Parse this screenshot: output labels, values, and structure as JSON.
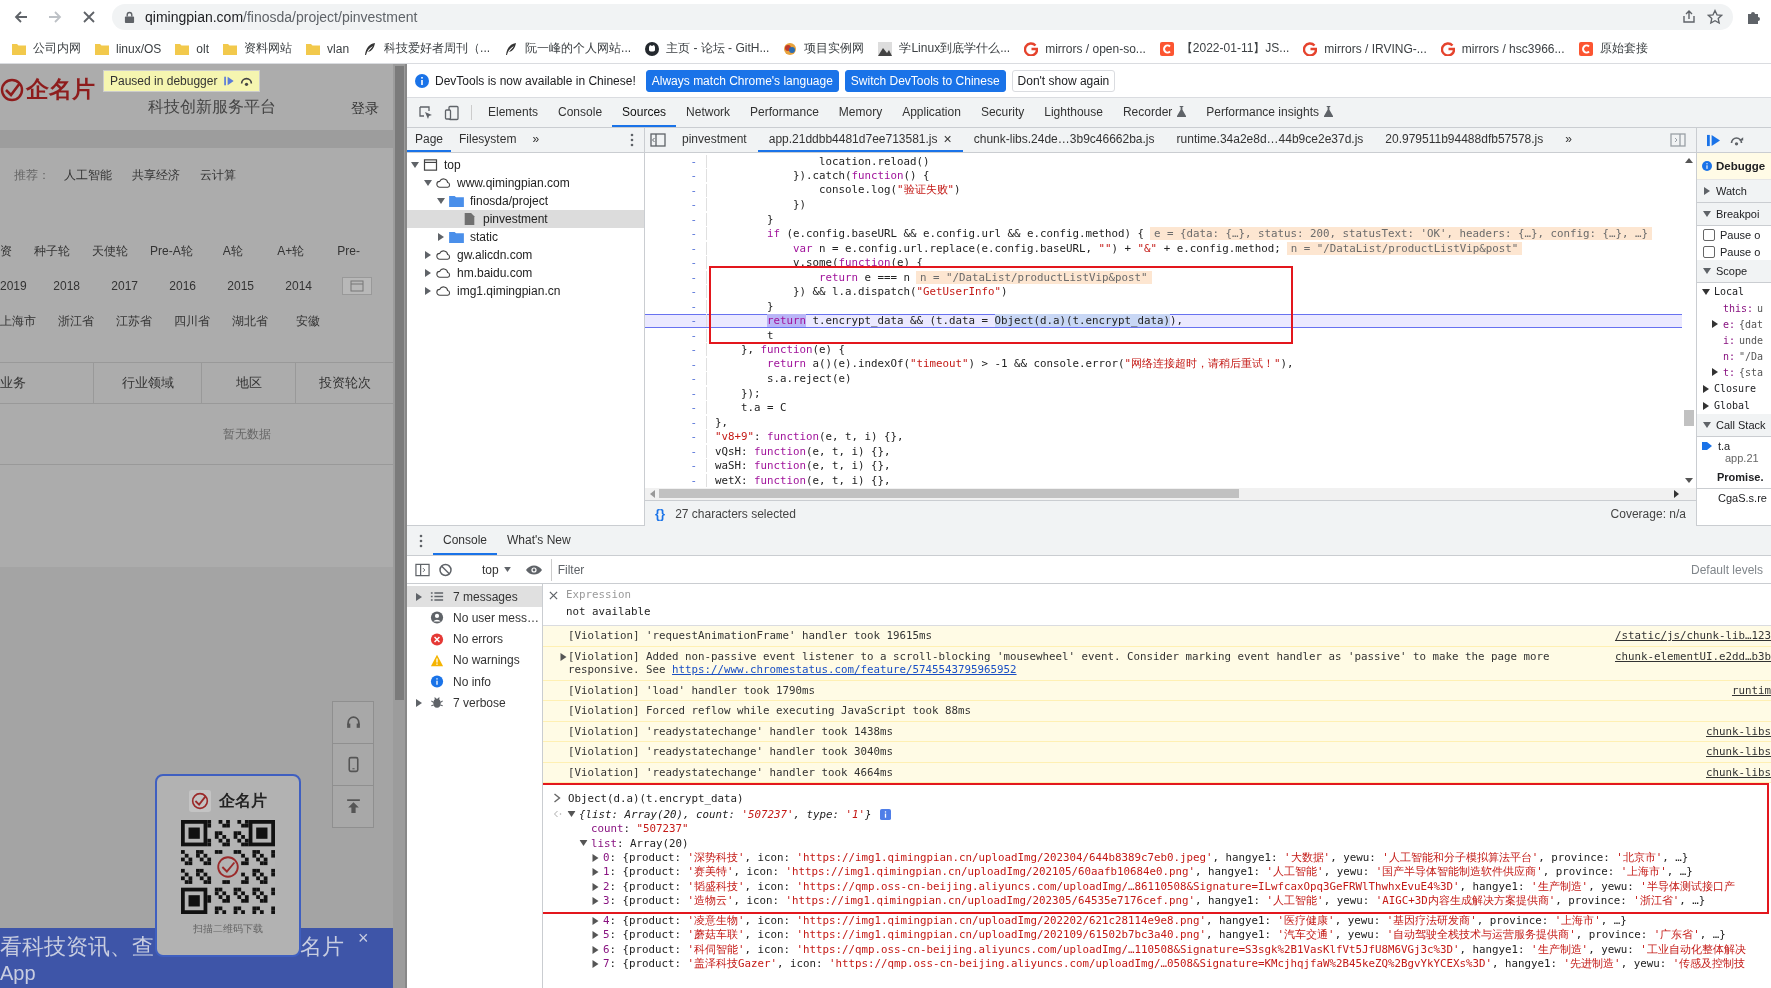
{
  "browser": {
    "url_host": "qimingpian.com",
    "url_path": "/finosda/project/pinvestment",
    "bookmarks": [
      {
        "label": "公司内网",
        "kind": "folder"
      },
      {
        "label": "linux/OS",
        "kind": "folder"
      },
      {
        "label": "olt",
        "kind": "folder"
      },
      {
        "label": "资料网站",
        "kind": "folder"
      },
      {
        "label": "vlan",
        "kind": "folder"
      },
      {
        "label": "科技爱好者周刊（...",
        "kind": "feather"
      },
      {
        "label": "阮一峰的个人网站...",
        "kind": "feather"
      },
      {
        "label": "主页 - 论坛 - GitH...",
        "kind": "cat"
      },
      {
        "label": "项目实例网",
        "kind": "colorful"
      },
      {
        "label": "学Linux到底学什么...",
        "kind": "photo"
      },
      {
        "label": "mirrors / open-so...",
        "kind": "g"
      },
      {
        "label": "【2022-01-11】JS...",
        "kind": "c"
      },
      {
        "label": "mirrors / IRVING-...",
        "kind": "g"
      },
      {
        "label": "mirrors / hsc3966...",
        "kind": "g"
      },
      {
        "label": "原始套接",
        "kind": "c"
      }
    ]
  },
  "page": {
    "brand": "企名片",
    "tagline": "科技创新服务平台",
    "login": "登录",
    "paused_label": "Paused in debugger",
    "recommend_label": "推荐：",
    "recommend": [
      "人工智能",
      "共享经济",
      "云计算"
    ],
    "filter_rows": [
      {
        "kind": "rounds",
        "items": [
          "资",
          "种子轮",
          "天使轮",
          "Pre-A轮",
          "A轮",
          "A+轮",
          "Pre-"
        ]
      },
      {
        "kind": "years",
        "items": [
          "2019",
          "2018",
          "2017",
          "2016",
          "2015",
          "2014"
        ]
      },
      {
        "kind": "regions",
        "items": [
          "上海市",
          "浙江省",
          "江苏省",
          "四川省",
          "湖北省",
          "安徽"
        ]
      }
    ],
    "table_headers": [
      "业务",
      "行业领域",
      "地区",
      "投资轮次"
    ],
    "empty": "暂无数据",
    "qr_brand": "企名片",
    "qr_caption": "扫描二维码下载",
    "banner_left": "看科技资讯、查",
    "banner_right": "名片",
    "banner_close": "×",
    "banner_app": "App"
  },
  "devtools": {
    "infobar": {
      "message": "DevTools is now available in Chinese!",
      "buttons": [
        {
          "label": "Always match Chrome's language",
          "kind": "primary"
        },
        {
          "label": "Switch DevTools to Chinese",
          "kind": "primary"
        },
        {
          "label": "Don't show again",
          "kind": "plain"
        }
      ]
    },
    "tabs": [
      {
        "label": "Elements",
        "selected": false,
        "kind": "panel"
      },
      {
        "label": "Console",
        "selected": false,
        "kind": "panel"
      },
      {
        "label": "Sources",
        "selected": true,
        "kind": "panel"
      },
      {
        "label": "Network",
        "selected": false,
        "kind": "panel"
      },
      {
        "label": "Performance",
        "selected": false,
        "kind": "panel"
      },
      {
        "label": "Memory",
        "selected": false,
        "kind": "panel"
      },
      {
        "label": "Application",
        "selected": false,
        "kind": "panel"
      },
      {
        "label": "Security",
        "selected": false,
        "kind": "panel"
      },
      {
        "label": "Lighthouse",
        "selected": false,
        "kind": "panel"
      },
      {
        "label": "Recorder",
        "selected": false,
        "kind": "experimental"
      },
      {
        "label": "Performance insights",
        "selected": false,
        "kind": "experimental"
      }
    ],
    "sources": {
      "nav_tabs": [
        {
          "label": "Page",
          "selected": true
        },
        {
          "label": "Filesystem",
          "selected": false
        }
      ],
      "nav_more": "»",
      "tree": [
        {
          "label": "top",
          "kind": "frame",
          "selected": false,
          "expanded": true,
          "children": [
            {
              "label": "www.qimingpian.com",
              "kind": "domain",
              "selected": false,
              "expanded": true,
              "children": [
                {
                  "label": "finosda/project",
                  "kind": "folder",
                  "selected": false,
                  "expanded": true,
                  "children": [
                    {
                      "label": "pinvestment",
                      "kind": "file",
                      "selected": true
                    }
                  ]
                },
                {
                  "label": "static",
                  "kind": "folder",
                  "selected": false,
                  "expanded": false
                }
              ]
            },
            {
              "label": "gw.alicdn.com",
              "kind": "domain",
              "selected": false,
              "expanded": false
            },
            {
              "label": "hm.baidu.com",
              "kind": "domain",
              "selected": false,
              "expanded": false
            },
            {
              "label": "img1.qimingpian.cn",
              "kind": "domain",
              "selected": false,
              "expanded": false
            }
          ]
        }
      ],
      "file_tabs": [
        {
          "label": "pinvestment",
          "selected": false
        },
        {
          "label": "app.21ddbb4481d7ee713581.js",
          "selected": true,
          "close": "×"
        },
        {
          "label": "chunk-libs.24de…3b9c46662ba.js",
          "selected": false
        },
        {
          "label": "runtime.34a2e8d…44b9ce2e37d.js",
          "selected": false
        },
        {
          "label": "20.979511b94488dfb57578.js",
          "selected": false
        }
      ],
      "file_more": "»",
      "code": [
        {
          "mark": "-",
          "current": false,
          "segs": [
            {
              "text": "                location.reload()",
              "kind": "plain"
            }
          ]
        },
        {
          "mark": "-",
          "current": false,
          "segs": [
            {
              "text": "            }).catch(",
              "kind": "plain"
            },
            {
              "text": "function",
              "kind": "keyword"
            },
            {
              "text": "() {",
              "kind": "plain"
            }
          ]
        },
        {
          "mark": "-",
          "current": false,
          "segs": [
            {
              "text": "                console.log(",
              "kind": "plain"
            },
            {
              "text": "\"验证失败\"",
              "kind": "string"
            },
            {
              "text": ")",
              "kind": "plain"
            }
          ]
        },
        {
          "mark": "-",
          "current": false,
          "segs": [
            {
              "text": "            })",
              "kind": "plain"
            }
          ]
        },
        {
          "mark": "-",
          "current": false,
          "segs": [
            {
              "text": "        }",
              "kind": "plain"
            }
          ]
        },
        {
          "mark": "-",
          "current": false,
          "segs": [
            {
              "text": "        if",
              "kind": "keyword"
            },
            {
              "text": " (e.config.baseURL && e.config.url && e.config.method) {",
              "kind": "plain"
            },
            {
              "text": "e = {data: {…}, status: 200, statusText: 'OK', headers: {…}, config: {…}, …}",
              "kind": "hint"
            }
          ]
        },
        {
          "mark": "-",
          "current": false,
          "segs": [
            {
              "text": "            var",
              "kind": "keyword"
            },
            {
              "text": " n = e.config.url.replace(e.config.baseURL, ",
              "kind": "plain"
            },
            {
              "text": "\"\"",
              "kind": "string"
            },
            {
              "text": ") + ",
              "kind": "plain"
            },
            {
              "text": "\"&\"",
              "kind": "string"
            },
            {
              "text": " + e.config.method;",
              "kind": "plain"
            },
            {
              "text": "n = \"/DataList/productListVip&post\"",
              "kind": "hint"
            }
          ]
        },
        {
          "mark": "-",
          "current": false,
          "segs": [
            {
              "text": "            v.some(",
              "kind": "plain"
            },
            {
              "text": "function",
              "kind": "keyword"
            },
            {
              "text": "(e) {",
              "kind": "plain"
            }
          ]
        },
        {
          "mark": "-",
          "current": false,
          "segs": [
            {
              "text": "                return",
              "kind": "keyword"
            },
            {
              "text": " e === n",
              "kind": "plain"
            },
            {
              "text": "n = \"/DataList/productListVip&post\"",
              "kind": "hint"
            }
          ]
        },
        {
          "mark": "-",
          "current": false,
          "segs": [
            {
              "text": "            }) && l.a.dispatch(",
              "kind": "plain"
            },
            {
              "text": "\"GetUserInfo\"",
              "kind": "string"
            },
            {
              "text": ")",
              "kind": "plain"
            }
          ]
        },
        {
          "mark": "-",
          "current": false,
          "segs": [
            {
              "text": "        }",
              "kind": "plain"
            }
          ]
        },
        {
          "mark": "-",
          "current": true,
          "segs": [
            {
              "text": "        return",
              "kind": "paused"
            },
            {
              "text": " t.encrypt_data && (t.data = ",
              "kind": "plain"
            },
            {
              "text": "Object(d.a)(t.encrypt_data)",
              "kind": "selection"
            },
            {
              "text": "),",
              "kind": "plain"
            }
          ]
        },
        {
          "mark": "-",
          "current": false,
          "segs": [
            {
              "text": "        t",
              "kind": "plain"
            }
          ]
        },
        {
          "mark": "-",
          "current": false,
          "segs": [
            {
              "text": "    }, ",
              "kind": "plain"
            },
            {
              "text": "function",
              "kind": "keyword"
            },
            {
              "text": "(e) {",
              "kind": "plain"
            }
          ]
        },
        {
          "mark": "-",
          "current": false,
          "segs": [
            {
              "text": "        return",
              "kind": "keyword"
            },
            {
              "text": " a()(e).indexOf(",
              "kind": "plain"
            },
            {
              "text": "\"timeout\"",
              "kind": "string"
            },
            {
              "text": ") > -1 && console.error(",
              "kind": "plain"
            },
            {
              "text": "\"网络连接超时，请稍后重试！\"",
              "kind": "string"
            },
            {
              "text": "),",
              "kind": "plain"
            }
          ]
        },
        {
          "mark": "-",
          "current": false,
          "segs": [
            {
              "text": "        s.a.reject(e)",
              "kind": "plain"
            }
          ]
        },
        {
          "mark": "-",
          "current": false,
          "segs": [
            {
              "text": "    });",
              "kind": "plain"
            }
          ]
        },
        {
          "mark": "-",
          "current": false,
          "segs": [
            {
              "text": "    t.a = C",
              "kind": "plain"
            }
          ]
        },
        {
          "mark": "-",
          "current": false,
          "segs": [
            {
              "text": "},",
              "kind": "plain"
            }
          ]
        },
        {
          "mark": "-",
          "current": false,
          "segs": [
            {
              "text": "\"v8+9\"",
              "kind": "string"
            },
            {
              "text": ": ",
              "kind": "plain"
            },
            {
              "text": "function",
              "kind": "keyword"
            },
            {
              "text": "(e, t, i) {},",
              "kind": "plain"
            }
          ]
        },
        {
          "mark": "-",
          "current": false,
          "segs": [
            {
              "text": "vQsH: ",
              "kind": "plain"
            },
            {
              "text": "function",
              "kind": "keyword"
            },
            {
              "text": "(e, t, i) {},",
              "kind": "plain"
            }
          ]
        },
        {
          "mark": "-",
          "current": false,
          "segs": [
            {
              "text": "waSH: ",
              "kind": "plain"
            },
            {
              "text": "function",
              "kind": "keyword"
            },
            {
              "text": "(e, t, i) {},",
              "kind": "plain"
            }
          ]
        },
        {
          "mark": "-",
          "current": false,
          "segs": [
            {
              "text": "wetX: ",
              "kind": "plain"
            },
            {
              "text": "function",
              "kind": "keyword"
            },
            {
              "text": "(e, t, i) {},",
              "kind": "plain"
            }
          ]
        }
      ],
      "format_label": "{}",
      "status": "27 characters selected",
      "coverage": "Coverage: n/a"
    },
    "debugger": [
      {
        "kind": "notice",
        "label": "Debugge"
      },
      {
        "kind": "section",
        "label": "Watch",
        "expanded": false
      },
      {
        "kind": "section",
        "label": "Breakpoi",
        "expanded": true
      },
      {
        "kind": "checkbox",
        "label": "Pause o",
        "checked": false
      },
      {
        "kind": "checkbox",
        "label": "Pause o",
        "checked": false
      },
      {
        "kind": "section",
        "label": "Scope",
        "expanded": true
      },
      {
        "kind": "group",
        "label": "Local",
        "expanded": true
      },
      {
        "kind": "var",
        "name": "this:",
        "value": "u"
      },
      {
        "kind": "objvar",
        "name": "e:",
        "value": "{dat",
        "expanded": false
      },
      {
        "kind": "var",
        "name": "i:",
        "value": "unde"
      },
      {
        "kind": "var",
        "name": "n:",
        "value": "\"/Da"
      },
      {
        "kind": "objvar",
        "name": "t:",
        "value": "{sta",
        "expanded": false
      },
      {
        "kind": "group",
        "label": "Closure",
        "expanded": false
      },
      {
        "kind": "group",
        "label": "Global",
        "expanded": false
      },
      {
        "kind": "section",
        "label": "Call Stack",
        "expanded": true
      },
      {
        "kind": "frame",
        "label": "t.a",
        "sub": "app.21",
        "current": true
      },
      {
        "kind": "async",
        "label": "Promise."
      },
      {
        "kind": "frame",
        "label": "CgaS.s.re",
        "current": false
      }
    ]
  },
  "console": {
    "tabs": [
      {
        "label": "Console",
        "selected": true
      },
      {
        "label": "What's New",
        "selected": false
      }
    ],
    "context": "top",
    "filter_placeholder": "Filter",
    "levels": "Default levels",
    "sidebar": [
      {
        "label": "7 messages",
        "kind": "messages",
        "selected": true,
        "expanded": false
      },
      {
        "label": "No user mess…",
        "kind": "user",
        "selected": false
      },
      {
        "label": "No errors",
        "kind": "errors",
        "selected": false
      },
      {
        "label": "No warnings",
        "kind": "warnings",
        "selected": false
      },
      {
        "label": "No info",
        "kind": "info",
        "selected": false
      },
      {
        "label": "7 verbose",
        "kind": "verbose",
        "selected": false,
        "expanded": false
      }
    ],
    "expression": {
      "title": "Expression",
      "value": "not available"
    },
    "violations": [
      {
        "text": "[Violation] 'requestAnimationFrame' handler took 19615ms",
        "source": "/static/js/chunk-lib…123"
      },
      {
        "text": "[Violation] Added non-passive event listener to a scroll-blocking 'mousewheel' event. Consider marking event handler as 'passive' to make the page more responsive. See ",
        "url": "https://www.chromestatus.com/feature/5745543795965952",
        "source": "chunk-elementUI.e2dd…b3b",
        "expanded": false
      },
      {
        "text": "[Violation] 'load' handler took 1790ms",
        "source": "runtim"
      },
      {
        "text": "[Violation] Forced reflow while executing JavaScript took 88ms"
      },
      {
        "text": "[Violation] 'readystatechange' handler took 1438ms",
        "source": "chunk-libs"
      },
      {
        "text": "[Violation] 'readystatechange' handler took 3040ms",
        "source": "chunk-libs"
      },
      {
        "text": "[Violation] 'readystatechange' handler took 4664ms",
        "source": "chunk-libs"
      }
    ],
    "input": "Object(d.a)(t.encrypt_data)",
    "results": [
      {
        "italic": true,
        "expanded": true,
        "segs": [
          {
            "text": "{list: Array(20), count: ",
            "kind": "plain"
          },
          {
            "text": "'507237'",
            "kind": "string"
          },
          {
            "text": ", type: ",
            "kind": "plain"
          },
          {
            "text": "'1'",
            "kind": "string"
          },
          {
            "text": "}",
            "kind": "plain"
          }
        ],
        "children": [
          {
            "segs": [
              {
                "text": "count",
                "kind": "key"
              },
              {
                "text": ": ",
                "kind": "plain"
              },
              {
                "text": "\"507237\"",
                "kind": "string"
              }
            ]
          },
          {
            "expanded": true,
            "segs": [
              {
                "text": "list",
                "kind": "key"
              },
              {
                "text": ": Array(20)",
                "kind": "plain"
              }
            ],
            "children": [
              {
                "expanded": false,
                "segs": [
                  {
                    "text": "0",
                    "kind": "key"
                  },
                  {
                    "text": ": {product: ",
                    "kind": "plain"
                  },
                  {
                    "text": "'深势科技'",
                    "kind": "string"
                  },
                  {
                    "text": ", icon: ",
                    "kind": "plain"
                  },
                  {
                    "text": "'https://img1.qimingpian.cn/uploadImg/202304/644b8389c7eb0.jpeg'",
                    "kind": "string"
                  },
                  {
                    "text": ", hangye1: ",
                    "kind": "plain"
                  },
                  {
                    "text": "'大数据'",
                    "kind": "string"
                  },
                  {
                    "text": ", yewu: ",
                    "kind": "plain"
                  },
                  {
                    "text": "'人工智能和分子模拟算法平台'",
                    "kind": "string"
                  },
                  {
                    "text": ", province: ",
                    "kind": "plain"
                  },
                  {
                    "text": "'北京市'",
                    "kind": "string"
                  },
                  {
                    "text": ", …}",
                    "kind": "plain"
                  }
                ]
              },
              {
                "expanded": false,
                "segs": [
                  {
                    "text": "1",
                    "kind": "key"
                  },
                  {
                    "text": ": {product: ",
                    "kind": "plain"
                  },
                  {
                    "text": "'赛美特'",
                    "kind": "string"
                  },
                  {
                    "text": ", icon: ",
                    "kind": "plain"
                  },
                  {
                    "text": "'https://img1.qimingpian.cn/uploadImg/202105/60aafb10684e0.png'",
                    "kind": "string"
                  },
                  {
                    "text": ", hangye1: ",
                    "kind": "plain"
                  },
                  {
                    "text": "'人工智能'",
                    "kind": "string"
                  },
                  {
                    "text": ", yewu: ",
                    "kind": "plain"
                  },
                  {
                    "text": "'国产半导体智能制造软件供应商'",
                    "kind": "string"
                  },
                  {
                    "text": ", province: ",
                    "kind": "plain"
                  },
                  {
                    "text": "'上海市'",
                    "kind": "string"
                  },
                  {
                    "text": ", …}",
                    "kind": "plain"
                  }
                ]
              },
              {
                "expanded": false,
                "segs": [
                  {
                    "text": "2",
                    "kind": "key"
                  },
                  {
                    "text": ": {product: ",
                    "kind": "plain"
                  },
                  {
                    "text": "'韬盛科技'",
                    "kind": "string"
                  },
                  {
                    "text": ", icon: ",
                    "kind": "plain"
                  },
                  {
                    "text": "'https://qmp.oss-cn-beijing.aliyuncs.com/uploadImg/…86110508&Signature=ILwfcaxOpq3GeFRWlThwhxEvuE4%3D'",
                    "kind": "string"
                  },
                  {
                    "text": ", hangye1: ",
                    "kind": "plain"
                  },
                  {
                    "text": "'生产制造'",
                    "kind": "string"
                  },
                  {
                    "text": ", yewu: ",
                    "kind": "plain"
                  },
                  {
                    "text": "'半导体测试接口产",
                    "kind": "string"
                  }
                ]
              },
              {
                "expanded": false,
                "segs": [
                  {
                    "text": "3",
                    "kind": "key"
                  },
                  {
                    "text": ": {product: ",
                    "kind": "plain"
                  },
                  {
                    "text": "'造物云'",
                    "kind": "string"
                  },
                  {
                    "text": ", icon: ",
                    "kind": "plain"
                  },
                  {
                    "text": "'https://img1.qimingpian.cn/uploadImg/202305/64535e7176cef.png'",
                    "kind": "string"
                  },
                  {
                    "text": ", hangye1: ",
                    "kind": "plain"
                  },
                  {
                    "text": "'人工智能'",
                    "kind": "string"
                  },
                  {
                    "text": ", yewu: ",
                    "kind": "plain"
                  },
                  {
                    "text": "'AIGC+3D内容生成解决方案提供商'",
                    "kind": "string"
                  },
                  {
                    "text": ", province: ",
                    "kind": "plain"
                  },
                  {
                    "text": "'浙江省'",
                    "kind": "string"
                  },
                  {
                    "text": ", …}",
                    "kind": "plain"
                  }
                ]
              },
              {
                "expanded": false,
                "segs": [
                  {
                    "text": "4",
                    "kind": "key"
                  },
                  {
                    "text": ": {product: ",
                    "kind": "plain"
                  },
                  {
                    "text": "'凌意生物'",
                    "kind": "string"
                  },
                  {
                    "text": ", icon: ",
                    "kind": "plain"
                  },
                  {
                    "text": "'https://img1.qimingpian.cn/uploadImg/202202/621c28114e9e8.png'",
                    "kind": "string"
                  },
                  {
                    "text": ", hangye1: ",
                    "kind": "plain"
                  },
                  {
                    "text": "'医疗健康'",
                    "kind": "string"
                  },
                  {
                    "text": ", yewu: ",
                    "kind": "plain"
                  },
                  {
                    "text": "'基因疗法研发商'",
                    "kind": "string"
                  },
                  {
                    "text": ", province: ",
                    "kind": "plain"
                  },
                  {
                    "text": "'上海市'",
                    "kind": "string"
                  },
                  {
                    "text": ", …}",
                    "kind": "plain"
                  }
                ]
              },
              {
                "expanded": false,
                "segs": [
                  {
                    "text": "5",
                    "kind": "key"
                  },
                  {
                    "text": ": {product: ",
                    "kind": "plain"
                  },
                  {
                    "text": "'蘑菇车联'",
                    "kind": "string"
                  },
                  {
                    "text": ", icon: ",
                    "kind": "plain"
                  },
                  {
                    "text": "'https://img1.qimingpian.cn/uploadImg/202109/61502b7bc3a40.png'",
                    "kind": "string"
                  },
                  {
                    "text": ", hangye1: ",
                    "kind": "plain"
                  },
                  {
                    "text": "'汽车交通'",
                    "kind": "string"
                  },
                  {
                    "text": ", yewu: ",
                    "kind": "plain"
                  },
                  {
                    "text": "'自动驾驶全栈技术与运营服务提供商'",
                    "kind": "string"
                  },
                  {
                    "text": ", province: ",
                    "kind": "plain"
                  },
                  {
                    "text": "'广东省'",
                    "kind": "string"
                  },
                  {
                    "text": ", …}",
                    "kind": "plain"
                  }
                ]
              },
              {
                "expanded": false,
                "segs": [
                  {
                    "text": "6",
                    "kind": "key"
                  },
                  {
                    "text": ": {product: ",
                    "kind": "plain"
                  },
                  {
                    "text": "'科伺智能'",
                    "kind": "string"
                  },
                  {
                    "text": ", icon: ",
                    "kind": "plain"
                  },
                  {
                    "text": "'https://qmp.oss-cn-beijing.aliyuncs.com/uploadImg/…110508&Signature=S3sgk%2B1VasKlfVt5JfU8M6VGj3c%3D'",
                    "kind": "string"
                  },
                  {
                    "text": ", hangye1: ",
                    "kind": "plain"
                  },
                  {
                    "text": "'生产制造'",
                    "kind": "string"
                  },
                  {
                    "text": ", yewu: ",
                    "kind": "plain"
                  },
                  {
                    "text": "'工业自动化整体解决",
                    "kind": "string"
                  }
                ]
              },
              {
                "expanded": false,
                "segs": [
                  {
                    "text": "7",
                    "kind": "key"
                  },
                  {
                    "text": ": {product: ",
                    "kind": "plain"
                  },
                  {
                    "text": "'盖泽科技Gazer'",
                    "kind": "string"
                  },
                  {
                    "text": ", icon: ",
                    "kind": "plain"
                  },
                  {
                    "text": "'https://qmp.oss-cn-beijing.aliyuncs.com/uploadImg/…0508&Signature=KMcjhqjfaW%2B45keZQ%2BgvYkYCEXs%3D'",
                    "kind": "string"
                  },
                  {
                    "text": ", hangye1: ",
                    "kind": "plain"
                  },
                  {
                    "text": "'先进制造'",
                    "kind": "string"
                  },
                  {
                    "text": ", yewu: ",
                    "kind": "plain"
                  },
                  {
                    "text": "'传感及控制技",
                    "kind": "string"
                  }
                ]
              }
            ]
          }
        ]
      }
    ]
  }
}
